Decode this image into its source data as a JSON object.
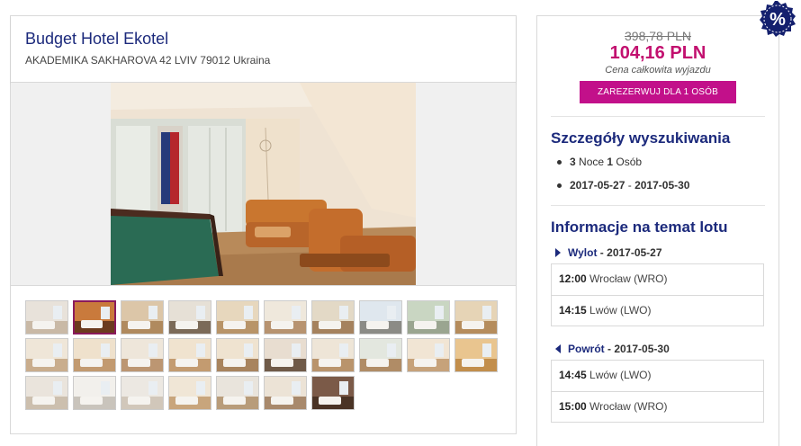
{
  "hotel": {
    "name": "Budget Hotel Ekotel",
    "address": "AKADEMIKA SAKHAROVA 42 LVIV 79012 Ukraina"
  },
  "gallery": {
    "main_photo_icon": "hotel-lounge-billiard-photo",
    "thumbnail_count": 27,
    "active_index": 1
  },
  "price": {
    "old": "398,78 PLN",
    "new": "104,16 PLN",
    "caption": "Cena całkowita wyjazdu",
    "book_label": "ZAREZERWUJ DLA 1 OSÓB"
  },
  "promo": {
    "symbol": "%"
  },
  "search_details": {
    "title": "Szczegóły wyszukiwania",
    "nights": "3",
    "nights_label": "Noce",
    "persons": "1",
    "persons_label": "Osób",
    "date_from": "2017-05-27",
    "date_sep": "-",
    "date_to": "2017-05-30"
  },
  "flights": {
    "title": "Informacje na temat lotu",
    "outbound": {
      "label": "Wylot",
      "sep": "-",
      "date": "2017-05-27",
      "legs": [
        {
          "time": "12:00",
          "place": "Wrocław (WRO)"
        },
        {
          "time": "14:15",
          "place": "Lwów (LWO)"
        }
      ]
    },
    "return": {
      "label": "Powrót",
      "sep": "-",
      "date": "2017-05-30",
      "legs": [
        {
          "time": "14:45",
          "place": "Lwów (LWO)"
        },
        {
          "time": "15:00",
          "place": "Wrocław (WRO)"
        }
      ]
    }
  },
  "colors": {
    "brand_navy": "#1c2a7c",
    "price_magenta": "#c2106f",
    "button_magenta": "#c2108a"
  }
}
